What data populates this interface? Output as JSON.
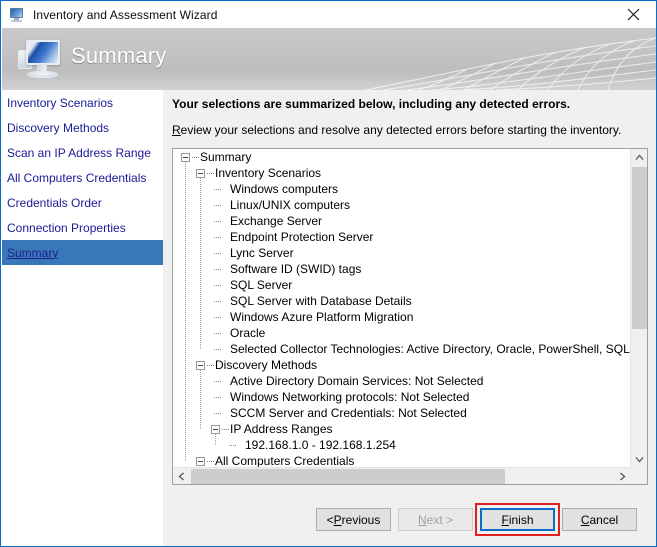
{
  "window": {
    "title": "Inventory and Assessment Wizard",
    "title_icon": "computer-monitor-icon",
    "close_label": "✕",
    "border_color": "#0a6cc4"
  },
  "header": {
    "title": "Summary",
    "icon": "computer-monitor-icon",
    "background_start": "#c9c9c9",
    "background_end": "#d2d2d2"
  },
  "sidebar": {
    "selected_color": "#3878b8",
    "link_color": "#1a1a96",
    "items": [
      {
        "label": "Inventory Scenarios",
        "selected": false
      },
      {
        "label": "Discovery Methods",
        "selected": false
      },
      {
        "label": "Scan an IP Address Range",
        "selected": false
      },
      {
        "label": "All Computers Credentials",
        "selected": false
      },
      {
        "label": "Credentials Order",
        "selected": false
      },
      {
        "label": "Connection Properties",
        "selected": false
      },
      {
        "label": "Summary",
        "selected": true
      }
    ]
  },
  "main": {
    "heading": "Your selections are summarized below, including any detected errors.",
    "subheading_accesskey": "R",
    "subheading_rest": "eview your selections and resolve any detected errors before starting the inventory.",
    "tree": [
      {
        "depth": 0,
        "label": "Summary",
        "expander": "minus"
      },
      {
        "depth": 1,
        "label": "Inventory Scenarios",
        "expander": "minus"
      },
      {
        "depth": 2,
        "label": "Windows computers",
        "expander": "none"
      },
      {
        "depth": 2,
        "label": "Linux/UNIX computers",
        "expander": "none"
      },
      {
        "depth": 2,
        "label": "Exchange Server",
        "expander": "none"
      },
      {
        "depth": 2,
        "label": "Endpoint Protection Server",
        "expander": "none"
      },
      {
        "depth": 2,
        "label": "Lync Server",
        "expander": "none"
      },
      {
        "depth": 2,
        "label": "Software ID (SWID) tags",
        "expander": "none"
      },
      {
        "depth": 2,
        "label": "SQL Server",
        "expander": "none"
      },
      {
        "depth": 2,
        "label": "SQL Server with Database Details",
        "expander": "none"
      },
      {
        "depth": 2,
        "label": "Windows Azure Platform Migration",
        "expander": "none"
      },
      {
        "depth": 2,
        "label": "Oracle",
        "expander": "none"
      },
      {
        "depth": 2,
        "label": "Selected Collector Technologies: Active Directory, Oracle, PowerShell, SQL Native,",
        "expander": "none"
      },
      {
        "depth": 1,
        "label": "Discovery Methods",
        "expander": "minus"
      },
      {
        "depth": 2,
        "label": "Active Directory Domain Services: Not Selected",
        "expander": "none"
      },
      {
        "depth": 2,
        "label": "Windows Networking protocols: Not Selected",
        "expander": "none"
      },
      {
        "depth": 2,
        "label": "SCCM Server and Credentials: Not Selected",
        "expander": "none"
      },
      {
        "depth": 2,
        "label": "IP Address Ranges",
        "expander": "minus"
      },
      {
        "depth": 3,
        "label": "192.168.1.0 - 192.168.1.254",
        "expander": "none"
      },
      {
        "depth": 1,
        "label": "All Computers Credentials",
        "expander": "minus"
      }
    ],
    "scrollbars": {
      "vertical_thumb_percent": 57,
      "horizontal_thumb_percent": 74,
      "up_arrow": "▲",
      "down_arrow": "▼",
      "left_arrow": "◀",
      "right_arrow": "▶"
    }
  },
  "buttons": {
    "previous": {
      "prefix": "< ",
      "accesskey": "P",
      "rest": "revious",
      "disabled": false
    },
    "next": {
      "prefix": "",
      "accesskey": "N",
      "rest": "ext >",
      "disabled": true
    },
    "finish": {
      "prefix": "",
      "accesskey": "F",
      "rest": "inish",
      "disabled": false,
      "focused": true
    },
    "cancel": {
      "prefix": "",
      "accesskey": "C",
      "rest": "ancel",
      "disabled": false
    }
  },
  "annotation": {
    "target": "finish-button",
    "color": "#e02020"
  }
}
